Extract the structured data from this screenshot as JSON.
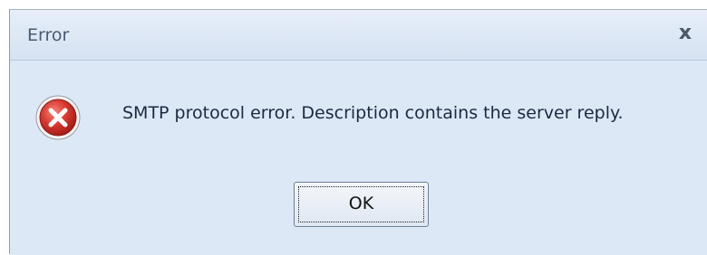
{
  "dialog": {
    "title": "Error",
    "close_glyph": "x",
    "icon": "error-icon",
    "message": "SMTP protocol error. Description contains the server reply.",
    "ok_label": "OK"
  },
  "colors": {
    "dialog_bg": "#dde8f6",
    "icon_red": "#d6342b",
    "text": "#1a2a40"
  }
}
